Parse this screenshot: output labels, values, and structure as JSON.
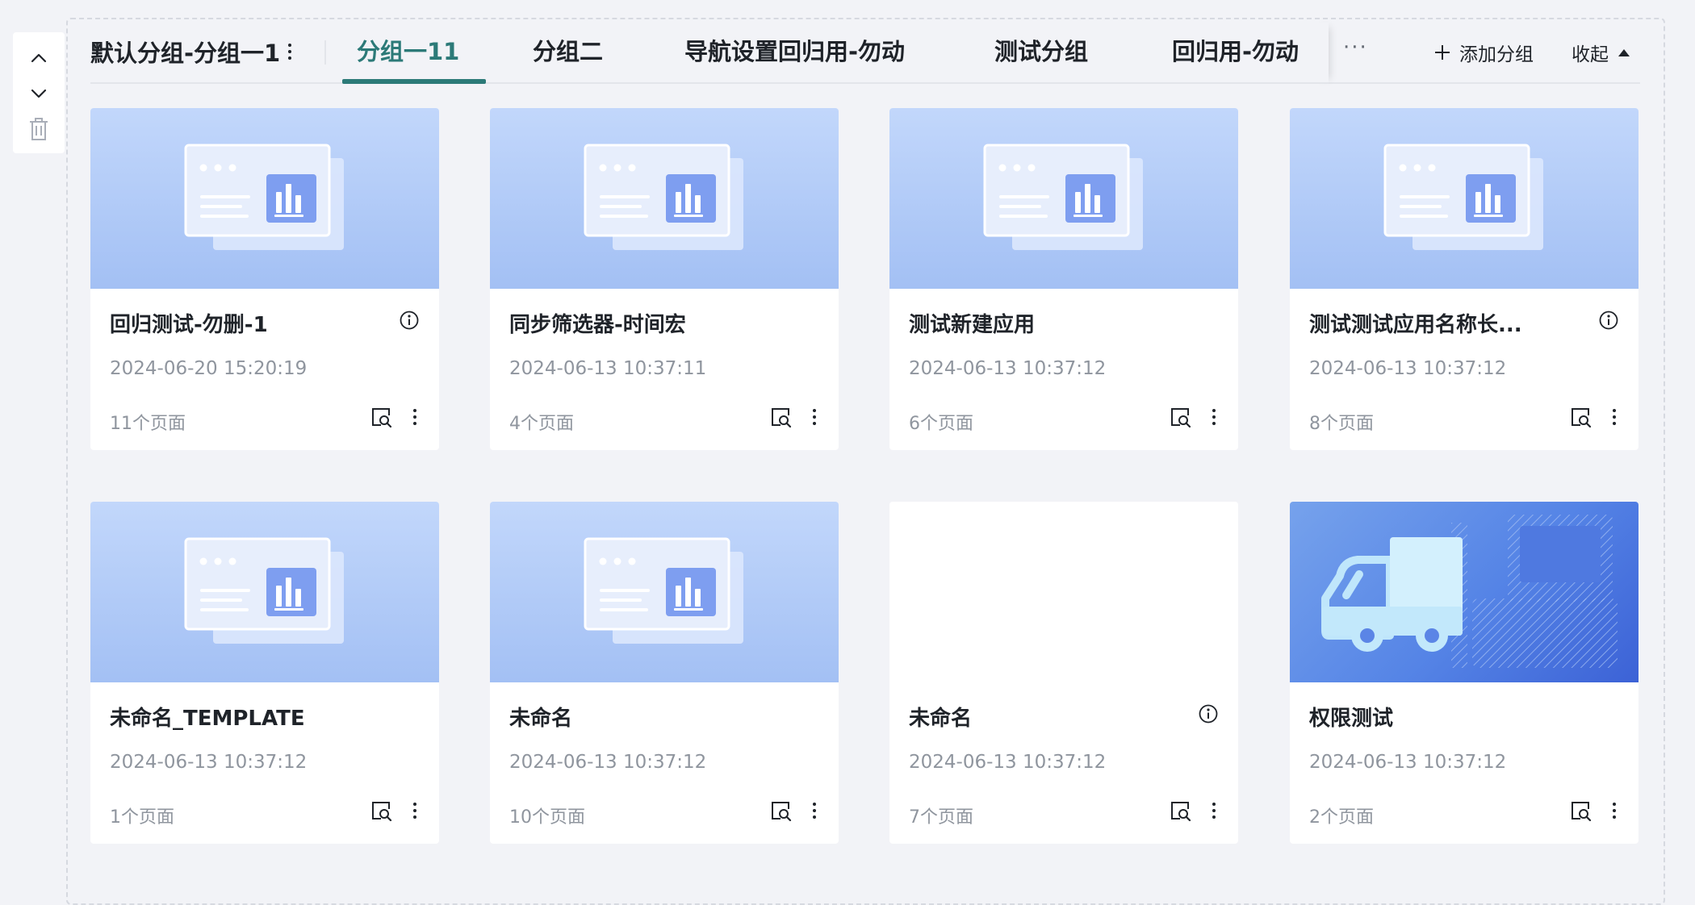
{
  "group": {
    "title": "默认分组-分组一1",
    "tabs": [
      {
        "label": "分组一11",
        "active": true
      },
      {
        "label": "分组二",
        "active": false
      },
      {
        "label": "导航设置回归用-勿动",
        "active": false
      },
      {
        "label": "测试分组",
        "active": false
      },
      {
        "label": "回归用-勿动",
        "active": false
      }
    ],
    "more_label": "···",
    "add_group_label": "添加分组",
    "collapse_label": "收起"
  },
  "colors": {
    "accent": "#2c7a78",
    "text_primary": "#1f2329",
    "text_secondary": "#8f959e",
    "thumb_blue": "#a3c0f4"
  },
  "cards": [
    {
      "title": "回归测试-勿删-1",
      "time": "2024-06-20 15:20:19",
      "pages": "11个页面",
      "thumb": "dashboard",
      "info": true
    },
    {
      "title": "同步筛选器-时间宏",
      "time": "2024-06-13 10:37:11",
      "pages": "4个页面",
      "thumb": "dashboard",
      "info": false
    },
    {
      "title": "测试新建应用",
      "time": "2024-06-13 10:37:12",
      "pages": "6个页面",
      "thumb": "dashboard",
      "info": false
    },
    {
      "title": "测试测试应用名称长...",
      "time": "2024-06-13 10:37:12",
      "pages": "8个页面",
      "thumb": "dashboard",
      "info": true
    },
    {
      "title": "未命名_TEMPLATE",
      "time": "2024-06-13 10:37:12",
      "pages": "1个页面",
      "thumb": "dashboard",
      "info": false
    },
    {
      "title": "未命名",
      "time": "2024-06-13 10:37:12",
      "pages": "10个页面",
      "thumb": "dashboard",
      "info": false
    },
    {
      "title": "未命名",
      "time": "2024-06-13 10:37:12",
      "pages": "7个页面",
      "thumb": "blank",
      "info": true
    },
    {
      "title": "权限测试",
      "time": "2024-06-13 10:37:12",
      "pages": "2个页面",
      "thumb": "truck",
      "info": false
    }
  ],
  "icons": {
    "move_up": "chevron-up-icon",
    "move_down": "chevron-down-icon",
    "delete": "trash-icon",
    "info": "info-icon",
    "preview": "preview-search-icon",
    "more": "more-vertical-icon",
    "add": "plus-icon",
    "collapse": "caret-up-icon"
  }
}
